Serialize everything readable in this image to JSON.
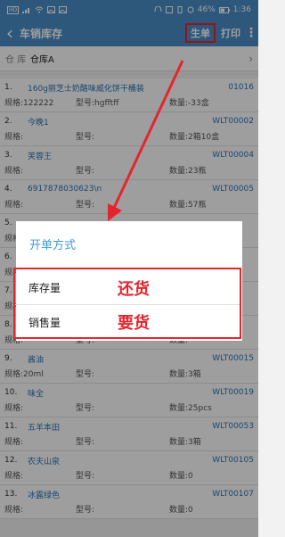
{
  "status_bar": {
    "left_icons": [
      "hd-icon",
      "signal-icon",
      "wifi-icon",
      "image-icon",
      "image-icon"
    ],
    "right_icons": [
      "headset-icon",
      "nfc-icon",
      "vibrate-icon",
      "alarm-icon",
      "battery-icon"
    ],
    "hd_label": "HD",
    "battery": "46%",
    "time": "1:36"
  },
  "app_bar": {
    "back_icon": "chevron-left-icon",
    "title": "车销库存",
    "action1": "生单",
    "action2": "打印",
    "more_icon": "more-vertical-icon"
  },
  "warehouse": {
    "label": "仓 库",
    "value": "仓库A",
    "chevron": "›"
  },
  "labels": {
    "spec": "规格:",
    "model": "型号:",
    "qty": "数量:"
  },
  "items": [
    {
      "index": "1.",
      "name": "160g丽芝士奶酪味威化饼干桶装",
      "code": "01016",
      "spec": "122222",
      "model": "hgfftff",
      "qty": "-33盒"
    },
    {
      "index": "2.",
      "name": "今晚1",
      "code": "WLT00002",
      "spec": "",
      "model": "",
      "qty": "2箱10盒"
    },
    {
      "index": "3.",
      "name": "芙蓉王",
      "code": "WLT00004",
      "spec": "",
      "model": "",
      "qty": "23瓶"
    },
    {
      "index": "4.",
      "name": "6917878030623\\n",
      "code": "WLT00005",
      "spec": "",
      "model": "",
      "qty": "57瓶"
    },
    {
      "index": "5.",
      "name": "",
      "code": "",
      "spec": "",
      "model": "",
      "qty": ""
    },
    {
      "index": "6.",
      "name": "",
      "code": "",
      "spec": "",
      "model": "",
      "qty": ""
    },
    {
      "index": "7.",
      "name": "",
      "code": "",
      "spec": "",
      "model": "",
      "qty": ""
    },
    {
      "index": "8.",
      "name": "",
      "code": "",
      "spec": "",
      "model": "",
      "qty": ""
    },
    {
      "index": "9.",
      "name": "酱油",
      "code": "WLT00015",
      "spec": "20ml",
      "model": "",
      "qty": "3箱"
    },
    {
      "index": "10.",
      "name": "味全",
      "code": "WLT00019",
      "spec": "",
      "model": "",
      "qty": "25pcs"
    },
    {
      "index": "11.",
      "name": "五羊本田",
      "code": "WLT00053",
      "spec": "",
      "model": "",
      "qty": "3箱"
    },
    {
      "index": "12.",
      "name": "农夫山泉",
      "code": "WLT00105",
      "spec": "",
      "model": "",
      "qty": "0"
    },
    {
      "index": "13.",
      "name": "冰露绿色",
      "code": "WLT00107",
      "spec": "",
      "model": "",
      "qty": "0"
    }
  ],
  "dialog": {
    "title": "开单方式",
    "options": [
      {
        "label": "库存量",
        "annotation": "还货"
      },
      {
        "label": "销售量",
        "annotation": "要货"
      }
    ]
  }
}
